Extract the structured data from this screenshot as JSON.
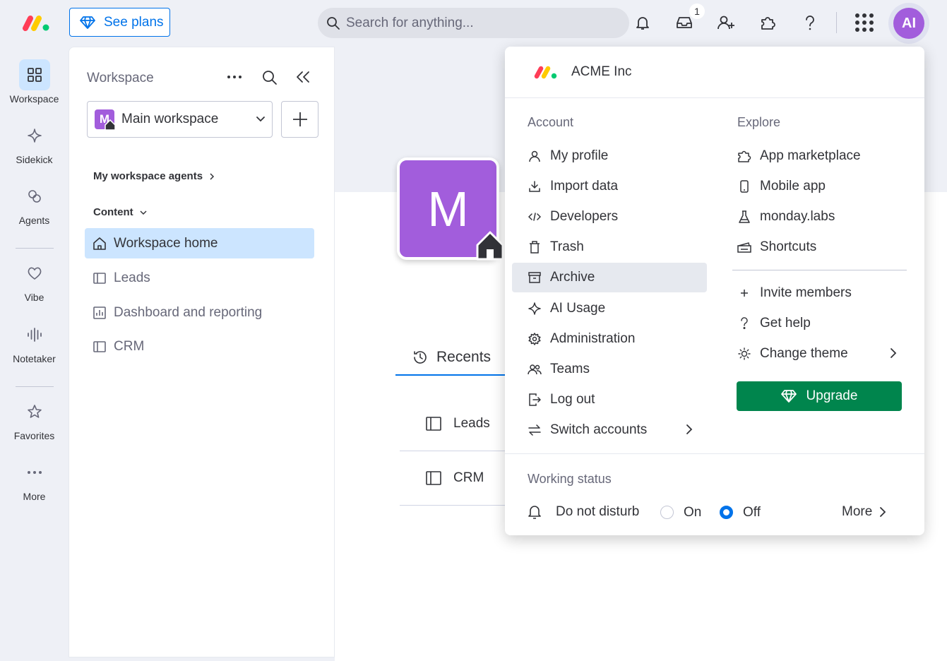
{
  "topbar": {
    "see_plans": "See plans",
    "search_placeholder": "Search for anything...",
    "inbox_badge": "1",
    "avatar_initials": "AI",
    "brand_colors": [
      "#ff3d57",
      "#ffcb00",
      "#00ca72"
    ]
  },
  "rail": {
    "items": [
      {
        "label": "Workspace",
        "icon": "grid-icon"
      },
      {
        "label": "Sidekick",
        "icon": "sparkle-icon"
      },
      {
        "label": "Agents",
        "icon": "agents-icon"
      },
      {
        "label": "Vibe",
        "icon": "heart-icon"
      },
      {
        "label": "Notetaker",
        "icon": "waveform-icon"
      },
      {
        "label": "Favorites",
        "icon": "star-icon"
      },
      {
        "label": "More",
        "icon": "more-icon"
      }
    ]
  },
  "workspace": {
    "title": "Workspace",
    "selected": "Main workspace",
    "badge_letter": "M",
    "agents_section": "My workspace agents",
    "content_section": "Content",
    "nav": [
      {
        "label": "Workspace home",
        "icon": "home-icon"
      },
      {
        "label": "Leads",
        "icon": "board-icon"
      },
      {
        "label": "Dashboard and reporting",
        "icon": "dashboard-icon"
      },
      {
        "label": "CRM",
        "icon": "board-icon"
      }
    ]
  },
  "main": {
    "logo_letter": "M",
    "recents_tab": "Recents",
    "recents": [
      "Leads",
      "CRM"
    ]
  },
  "menu": {
    "account_name": "ACME Inc",
    "account_title": "Account",
    "explore_title": "Explore",
    "account_items": [
      {
        "label": "My profile",
        "icon": "user-icon"
      },
      {
        "label": "Import data",
        "icon": "download-icon"
      },
      {
        "label": "Developers",
        "icon": "code-icon"
      },
      {
        "label": "Trash",
        "icon": "trash-icon"
      },
      {
        "label": "Archive",
        "icon": "archive-icon"
      },
      {
        "label": "AI Usage",
        "icon": "sparkle-icon"
      },
      {
        "label": "Administration",
        "icon": "gear-icon"
      },
      {
        "label": "Teams",
        "icon": "team-icon"
      },
      {
        "label": "Log out",
        "icon": "logout-icon"
      },
      {
        "label": "Switch accounts",
        "icon": "switch-icon"
      }
    ],
    "explore_items": [
      {
        "label": "App marketplace",
        "icon": "puzzle-icon"
      },
      {
        "label": "Mobile app",
        "icon": "mobile-icon"
      },
      {
        "label": "monday.labs",
        "icon": "flask-icon"
      },
      {
        "label": "Shortcuts",
        "icon": "keyboard-icon"
      }
    ],
    "extra_items": [
      {
        "label": "Invite members",
        "icon": "plus-icon"
      },
      {
        "label": "Get help",
        "icon": "question-icon"
      },
      {
        "label": "Change theme",
        "icon": "sun-icon"
      }
    ],
    "upgrade_label": "Upgrade",
    "working_status_title": "Working status",
    "dnd_label": "Do not disturb",
    "on_label": "On",
    "off_label": "Off",
    "selected_status": "Off",
    "more_label": "More",
    "upgrade_color": "#00854d"
  }
}
